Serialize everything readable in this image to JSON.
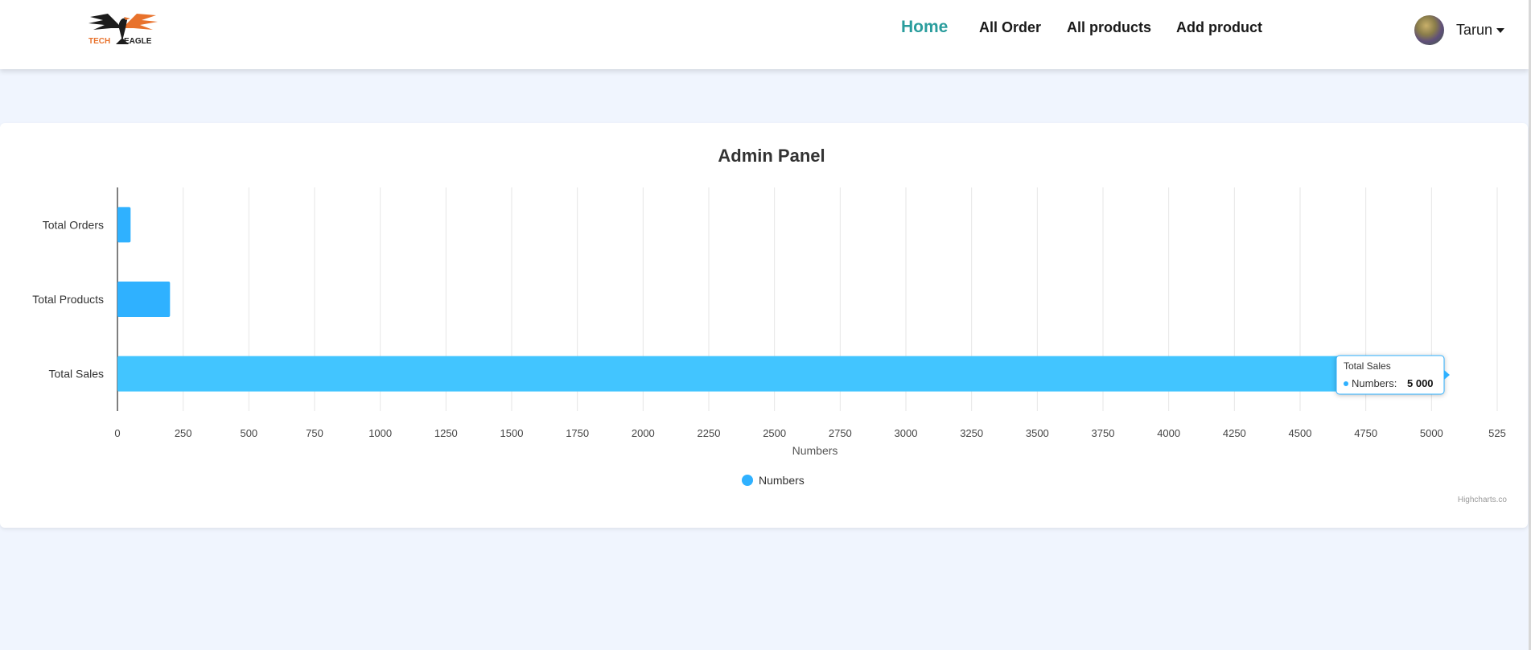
{
  "brand": {
    "logo_text_left": "TECH",
    "logo_text_right": "EAGLE",
    "accent": "#e8722c"
  },
  "nav": {
    "items": [
      {
        "label": "Home",
        "active": true
      },
      {
        "label": "All Order",
        "active": false
      },
      {
        "label": "All products",
        "active": false
      },
      {
        "label": "Add product",
        "active": false
      }
    ],
    "active_color": "#2a9d9d"
  },
  "user": {
    "name": "Tarun"
  },
  "chart_data": {
    "type": "bar",
    "orientation": "horizontal",
    "title": "Admin Panel",
    "categories": [
      "Total Orders",
      "Total Products",
      "Total Sales"
    ],
    "series": [
      {
        "name": "Numbers",
        "values": [
          50,
          200,
          5000
        ],
        "color": "#2fb1ff"
      }
    ],
    "xlabel": "Numbers",
    "ylabel": "",
    "xlim": [
      0,
      5250
    ],
    "x_ticks": [
      "0",
      "250",
      "500",
      "750",
      "1000",
      "1250",
      "1500",
      "1750",
      "2000",
      "2250",
      "2500",
      "2750",
      "3000",
      "3250",
      "3500",
      "3750",
      "4000",
      "4250",
      "4500",
      "4750",
      "5000",
      "525"
    ],
    "grid": true,
    "legend_position": "bottom-center",
    "tooltip": {
      "category": "Total Sales",
      "series": "Numbers",
      "value_label": "5 000"
    },
    "credits": "Highcharts.co"
  }
}
